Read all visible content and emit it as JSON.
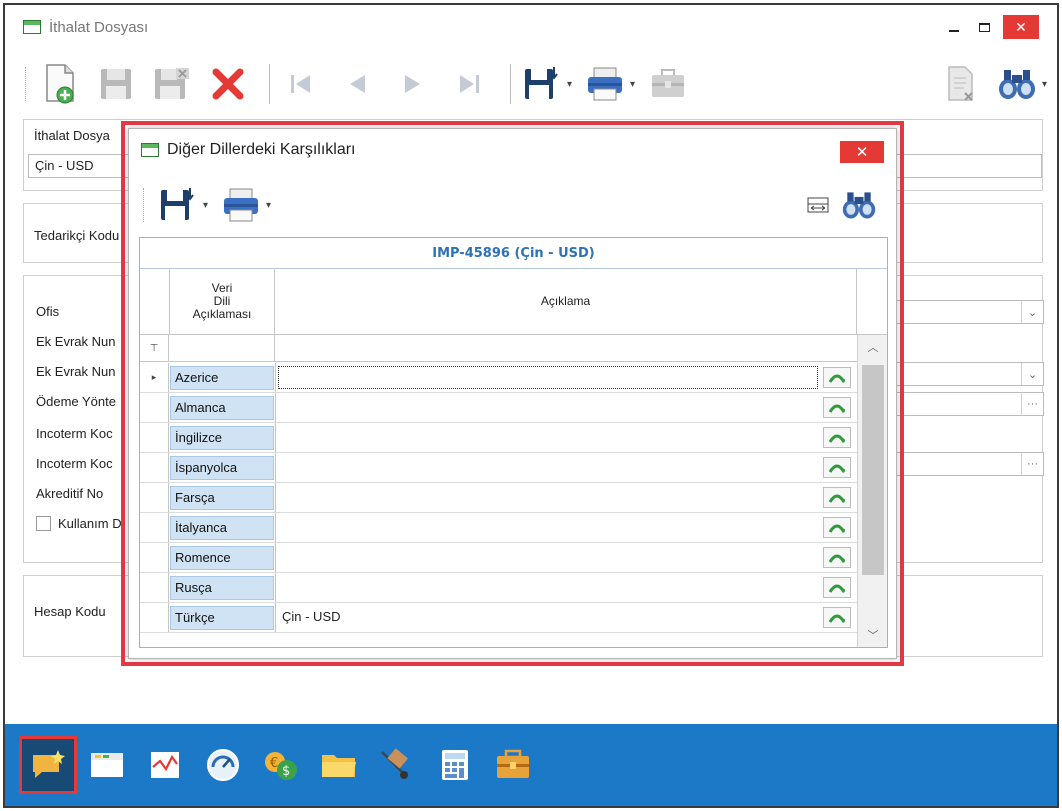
{
  "main_window": {
    "title": "İthalat Dosyası",
    "buttons": {
      "minimize": "minimize",
      "maximize": "maximize",
      "close": "✕"
    },
    "toolbar_icons": [
      "new-doc-icon",
      "save-icon",
      "save-close-icon",
      "delete-icon",
      "first-record-icon",
      "prev-record-icon",
      "next-record-icon",
      "last-record-icon",
      "export-icon",
      "print-icon",
      "briefcase-icon",
      "cancel-doc-icon",
      "binoculars-icon"
    ],
    "form": {
      "ithalat_dosya_label": "İthalat Dosya",
      "ithalat_dosya_value": "Çin - USD",
      "tedarikci_label": "Tedarikçi Kodu",
      "ofis_label": "Ofis",
      "ek_evrak_1_label": "Ek Evrak Nun",
      "ek_evrak_2_label": "Ek Evrak Nun",
      "odeme_label": "Ödeme Yönte",
      "incoterm_1_label": "Incoterm Koc",
      "incoterm_2_label": "Incoterm Koc",
      "akreditif_label": "Akreditif No",
      "kullanim_label": "Kullanım D",
      "hesap_label": "Hesap Kodu",
      "ellipsis": "···",
      "chevron": "⌄"
    },
    "bottom_bar_icons": [
      "note-icon",
      "window-icon",
      "chart-icon",
      "gauge-icon",
      "money-icon",
      "folder-icon",
      "hand-truck-icon",
      "calculator-icon",
      "toolbox-icon"
    ]
  },
  "dialog": {
    "title": "Diğer Dillerdeki Karşılıkları",
    "close_label": "✕",
    "grid": {
      "title": "IMP-45896 (Çin - USD)",
      "col_language": "Veri\nDili\nAçıklaması",
      "col_description": "Açıklama",
      "filter_icon": "⊤",
      "rows": [
        {
          "language": "Azerice",
          "description": ""
        },
        {
          "language": "Almanca",
          "description": ""
        },
        {
          "language": "İngilizce",
          "description": ""
        },
        {
          "language": "İspanyolca",
          "description": ""
        },
        {
          "language": "Farsça",
          "description": ""
        },
        {
          "language": "İtalyanca",
          "description": ""
        },
        {
          "language": "Romence",
          "description": ""
        },
        {
          "language": "Rusça",
          "description": ""
        },
        {
          "language": "Türkçe",
          "description": "Çin - USD"
        }
      ]
    }
  },
  "colors": {
    "accent_red": "#e53945",
    "bottom_bar": "#1c79c7",
    "grid_title": "#2e72b8",
    "lang_cell": "#cfe3f5"
  }
}
